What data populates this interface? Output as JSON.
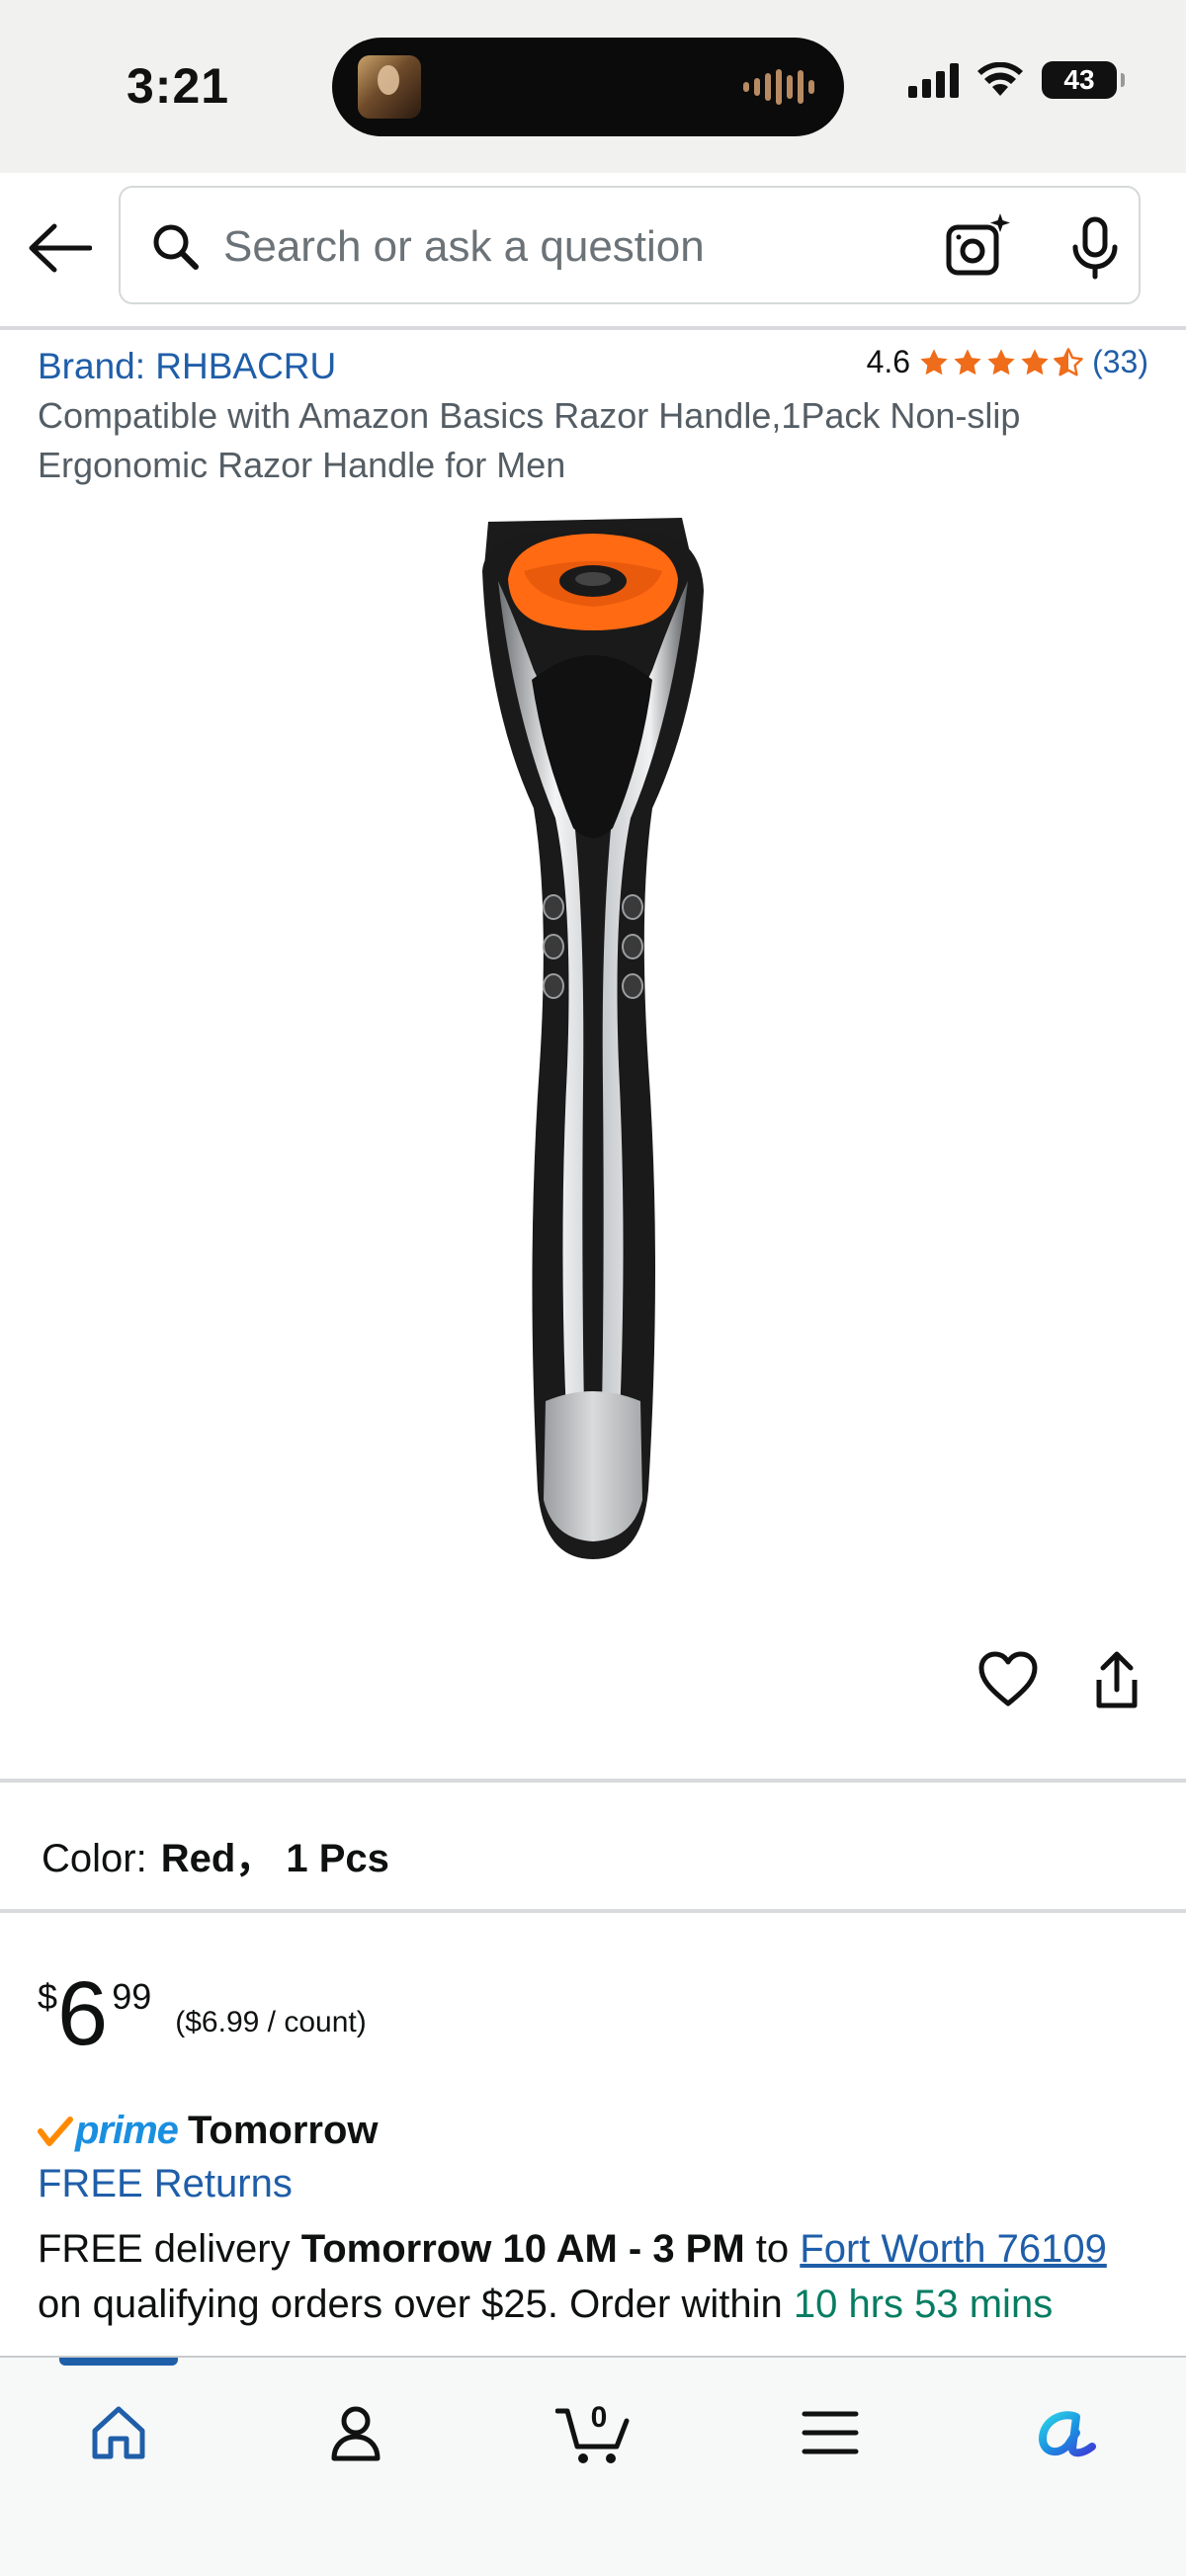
{
  "status_bar": {
    "time": "3:21",
    "battery": "43"
  },
  "search": {
    "placeholder": "Search or ask a question"
  },
  "product": {
    "brand_label": "Brand: RHBACRU",
    "rating": "4.6",
    "rating_stars": 4.6,
    "rating_count": "(33)",
    "title": "Compatible with Amazon Basics Razor Handle,1Pack Non-slip Ergonomic Razor Handle for Men"
  },
  "variant": {
    "label": "Color:",
    "value": "Red，  1 Pcs"
  },
  "price": {
    "symbol": "$",
    "whole": "6",
    "fraction": "99",
    "unit_price": "($6.99 / count)"
  },
  "shipping": {
    "prime_label": "prime",
    "prime_day": "Tomorrow",
    "free_returns": "FREE Returns",
    "delivery_prefix": "FREE delivery ",
    "delivery_window": "Tomorrow 10 AM - 3 PM",
    "delivery_to": " to ",
    "location": "Fort Worth 76109",
    "delivery_suffix": " on qualifying orders over $25. Order within ",
    "countdown": "10 hrs 53 mins"
  },
  "bottom_nav": {
    "cart_count": "0",
    "active": "home"
  },
  "colors": {
    "link": "#1f5ea8",
    "prime_blue": "#1a8fe0",
    "star_orange": "#ee6c1a",
    "countdown_green": "#067d62"
  }
}
